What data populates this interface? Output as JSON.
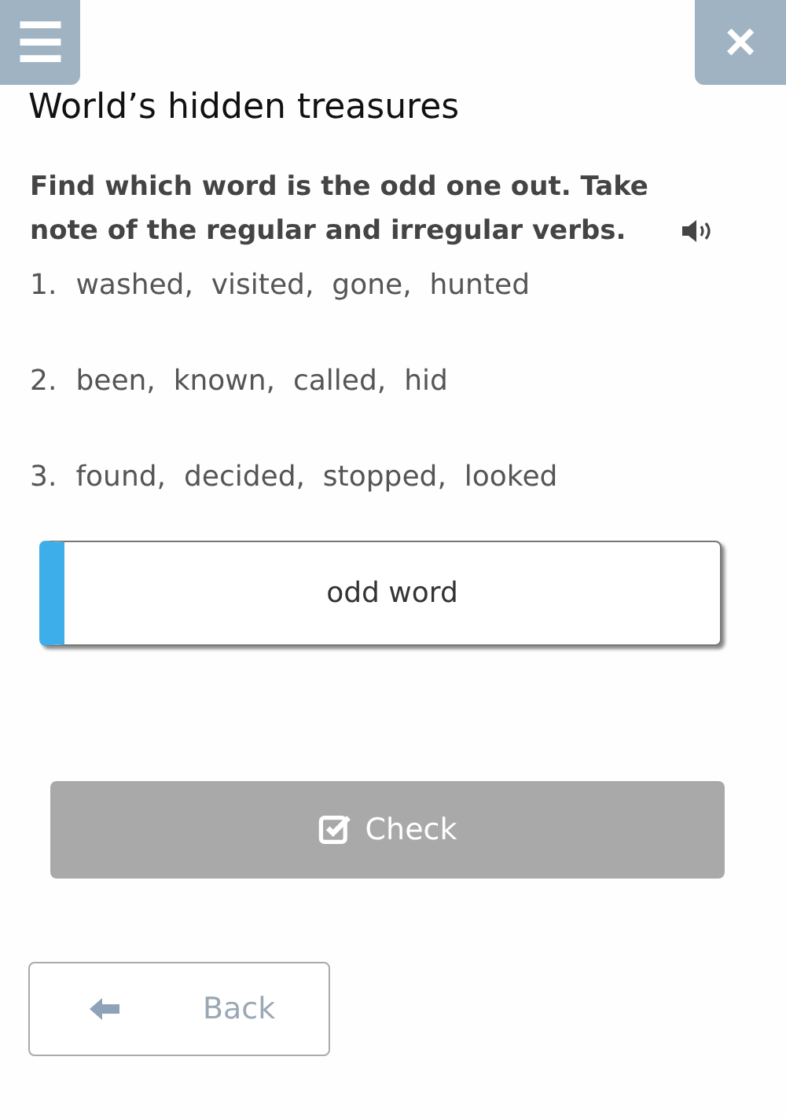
{
  "header": {
    "menu_icon": "☰",
    "close_icon": "×"
  },
  "title": "World’s hidden treasures",
  "instruction": "Find which word is the odd one out. Take note of the regular and irregular verbs.",
  "items": [
    {
      "number": "1.",
      "text": "washed,  visited,  gone,  hunted"
    },
    {
      "number": "2.",
      "text": "been,  known,  called,  hid"
    },
    {
      "number": "3.",
      "text": "found,  decided,  stopped,  looked"
    }
  ],
  "answer_field": {
    "placeholder": "odd word"
  },
  "check_button": {
    "label": "Check",
    "disabled": true
  },
  "back_button": {
    "label": "Back"
  }
}
